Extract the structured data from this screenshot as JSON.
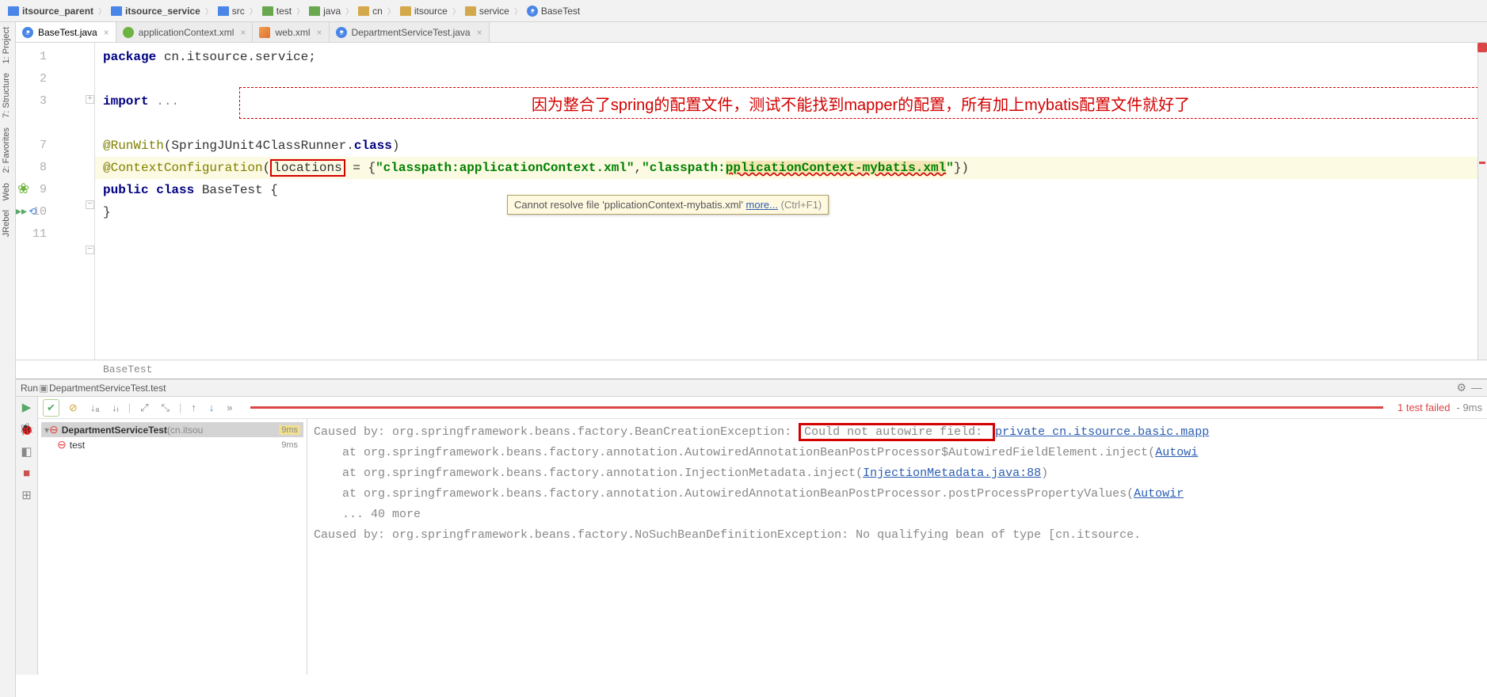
{
  "breadcrumb": [
    {
      "icon": "module",
      "label": "itsource_parent"
    },
    {
      "icon": "module",
      "label": "itsource_service"
    },
    {
      "icon": "folder-blue",
      "label": "src"
    },
    {
      "icon": "folder-green",
      "label": "test"
    },
    {
      "icon": "folder-green",
      "label": "java"
    },
    {
      "icon": "folder",
      "label": "cn"
    },
    {
      "icon": "folder",
      "label": "itsource"
    },
    {
      "icon": "folder",
      "label": "service"
    },
    {
      "icon": "java",
      "label": "BaseTest"
    }
  ],
  "tabs": [
    {
      "icon": "java",
      "label": "BaseTest.java",
      "active": true
    },
    {
      "icon": "spring",
      "label": "applicationContext.xml",
      "active": false
    },
    {
      "icon": "xml",
      "label": "web.xml",
      "active": false
    },
    {
      "icon": "java",
      "label": "DepartmentServiceTest.java",
      "active": false
    }
  ],
  "left_tools": [
    "1: Project",
    "7: Structure",
    "2: Favorites",
    "Web",
    "JRebel"
  ],
  "code": {
    "l1_pkg_kw": "package",
    "l1_pkg": " cn.itsource.service;",
    "l3_imp_kw": "import",
    "l3_imp": " ...",
    "l7_ann": "@RunWith",
    "l7_open": "(SpringJUnit4ClassRunner.",
    "l7_class_kw": "class",
    "l7_close": ")",
    "l8_ann": "@ContextConfiguration",
    "l8_open": "(",
    "l8_loc": "locations",
    "l8_eq": " = {",
    "l8_s1": "\"classpath:applicationContext.xml\"",
    "l8_comma": ",",
    "l8_s2a": "\"classpath:",
    "l8_bad": "pplicationContext-mybatis.xml",
    "l8_s2b": "\"",
    "l8_close": "})",
    "l9_pub": "public class",
    "l9_name": " BaseTest {",
    "l10": "}"
  },
  "line_numbers": [
    "1",
    "2",
    "3",
    "",
    "7",
    "8",
    "9",
    "10",
    "11"
  ],
  "annotation": "因为整合了spring的配置文件，测试不能找到mapper的配置，所有加上mybatis配置文件就好了",
  "tooltip": {
    "msg": "Cannot resolve file 'pplicationContext-mybatis.xml' ",
    "link": "more...",
    "shortcut": " (Ctrl+F1)"
  },
  "editor_crumb": "BaseTest",
  "run": {
    "title_pre": "Run  ",
    "title": "DepartmentServiceTest.test",
    "status": "1 test failed",
    "status_time": " - 9ms",
    "tree": [
      {
        "icon": "fail",
        "label": "DepartmentServiceTest",
        "gray": " (cn.itsou",
        "time": "9ms",
        "sel": true,
        "indent": 0
      },
      {
        "icon": "fail",
        "label": "test",
        "time": "9ms",
        "sel": false,
        "indent": 1
      }
    ],
    "console": [
      {
        "t": "Caused by: org.springframework.beans.factory.BeanCreationException: ",
        "box": "Could not autowire field: ",
        "link": "private cn.itsource.basic.mapp"
      },
      {
        "t": "    at org.springframework.beans.factory.annotation.AutowiredAnnotationBeanPostProcessor$AutowiredFieldElement.inject(",
        "link": "Autowi"
      },
      {
        "t": "    at org.springframework.beans.factory.annotation.InjectionMetadata.inject(",
        "link": "InjectionMetadata.java:88",
        "after": ")"
      },
      {
        "t": "    at org.springframework.beans.factory.annotation.AutowiredAnnotationBeanPostProcessor.postProcessPropertyValues(",
        "link": "Autowir"
      },
      {
        "t": "    ... 40 more"
      },
      {
        "t": "Caused by: org.springframework.beans.factory.NoSuchBeanDefinitionException: No qualifying bean of type [cn.itsource."
      }
    ]
  }
}
